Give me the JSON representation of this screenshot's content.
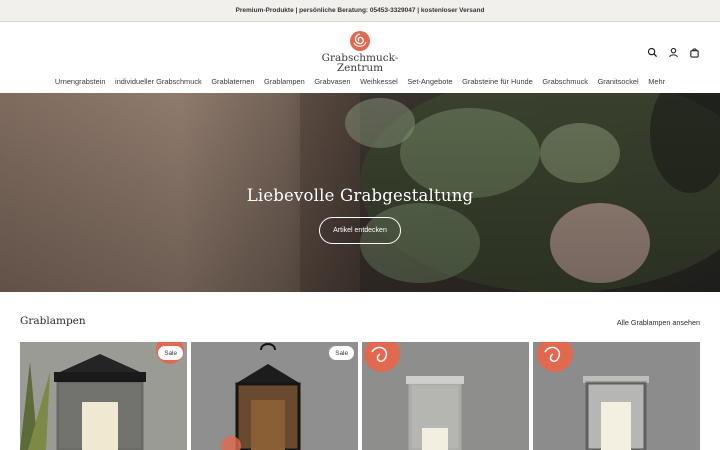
{
  "announcement": "Premium-Produkte | persönliche Beratung: 05453-3329047 | kostenloser Versand",
  "logo": {
    "line1": "Grabschmuck-",
    "line2": "Zentrum"
  },
  "header_icons": [
    "search-icon",
    "account-icon",
    "cart-icon"
  ],
  "nav": [
    "Urnengrabstein",
    "individueller Grabschmuck",
    "Grablaternen",
    "Grablampen",
    "Grabvasen",
    "Weihkessel",
    "Set-Angebote",
    "Grabsteine für Hunde",
    "Grabschmuck",
    "Granitsockel",
    "Mehr"
  ],
  "hero": {
    "title": "Liebevolle Grabgestaltung",
    "button": "Artikel entdecken"
  },
  "section": {
    "title": "Grablampen",
    "link": "Alle Grablampen ansehen"
  },
  "products": [
    {
      "badge": "Sale"
    },
    {
      "badge": "Sale"
    },
    {
      "badge": ""
    },
    {
      "badge": ""
    }
  ],
  "colors": {
    "accent": "#e0694f",
    "topbar": "#f1f0ec"
  }
}
